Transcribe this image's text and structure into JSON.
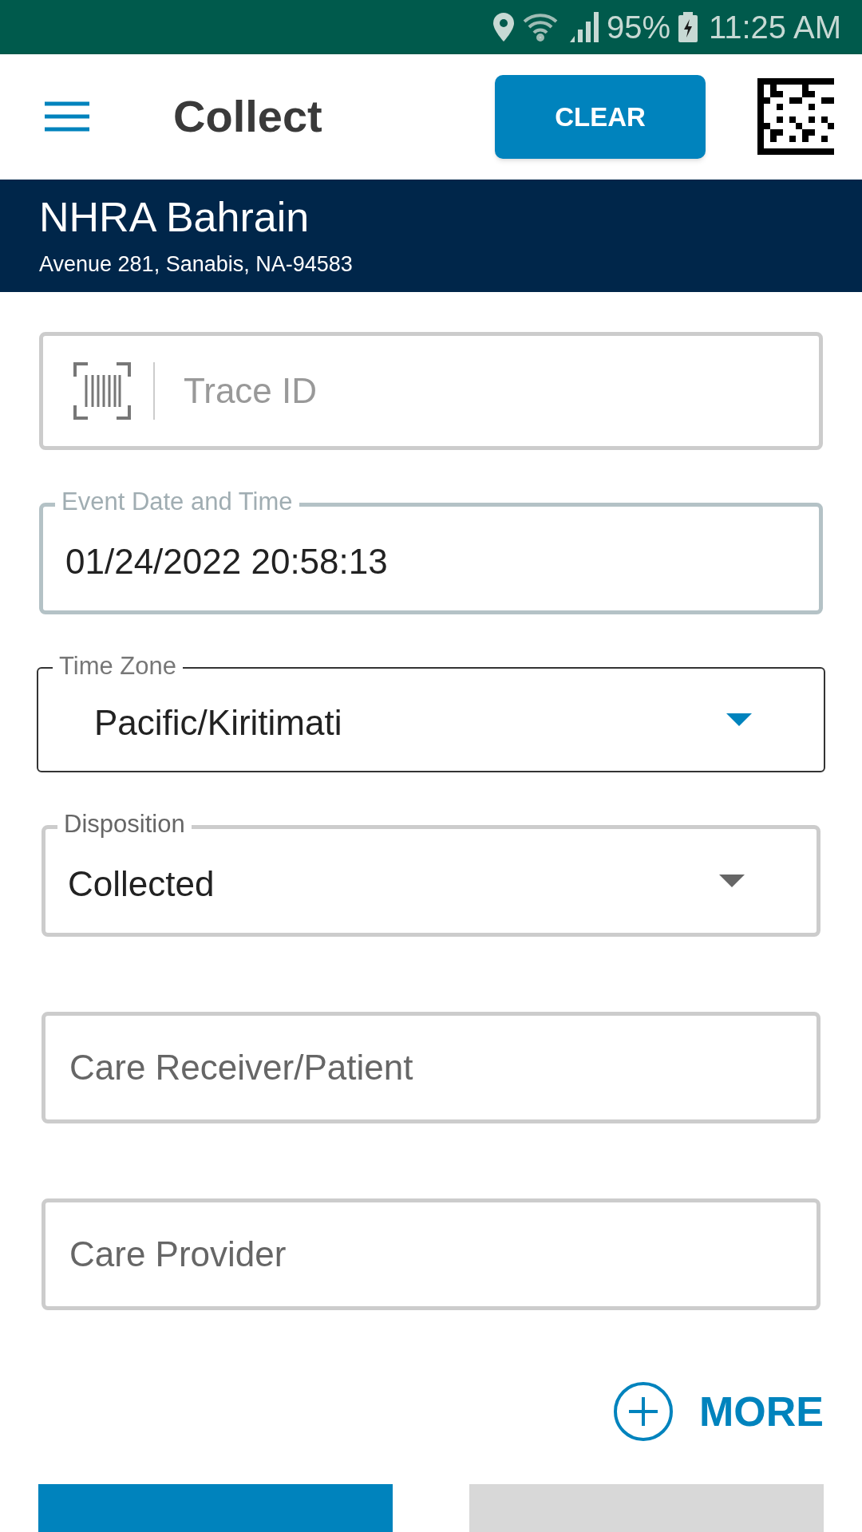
{
  "status_bar": {
    "battery": "95%",
    "time": "11:25 AM"
  },
  "app_bar": {
    "title": "Collect",
    "action": "CLEAR"
  },
  "location": {
    "name": "NHRA Bahrain",
    "address": "Avenue 281, Sanabis, NA-94583"
  },
  "fields": [
    {
      "kind": "scan",
      "placeholder": "Trace ID"
    },
    {
      "kind": "text",
      "label": "Event Date and Time",
      "value": "01/24/2022 20:58:13"
    },
    {
      "kind": "select",
      "label": "Time Zone",
      "value": "Pacific/Kiritimati",
      "focused": true
    },
    {
      "kind": "select",
      "label": "Disposition",
      "value": "Collected",
      "focused": false
    },
    {
      "kind": "text",
      "placeholder": "Care Receiver/Patient"
    },
    {
      "kind": "text",
      "placeholder": "Care Provider"
    }
  ],
  "more": {
    "label": "MORE"
  },
  "bottom_buttons": [
    {
      "kind": "primary"
    },
    {
      "kind": "secondary"
    }
  ]
}
